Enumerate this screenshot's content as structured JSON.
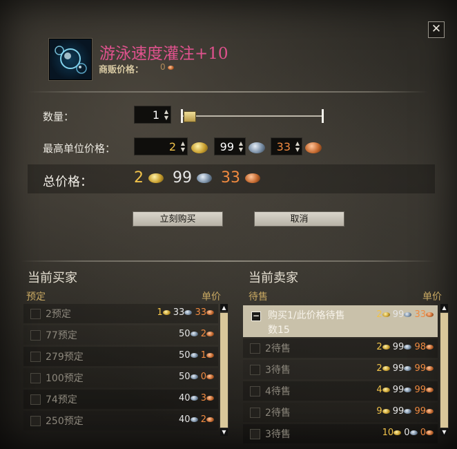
{
  "close_label": "✕",
  "item": {
    "title": "游泳速度灌注+10",
    "icon": "water-bubbles-icon",
    "vendor_label": "商贩价格：",
    "vendor_value": "0"
  },
  "quantity": {
    "label": "数量：",
    "value": "1",
    "slider_fraction": 0.05
  },
  "max_unit_price": {
    "label": "最高单位价格：",
    "gold": "2",
    "silver": "99",
    "copper": "33"
  },
  "total": {
    "label": "总价格：",
    "gold": "2",
    "silver": "99",
    "copper": "33"
  },
  "buttons": {
    "buy_now": "立刻购买",
    "cancel": "取消"
  },
  "buyers": {
    "title": "当前买家",
    "col_left": "预定",
    "col_right": "单价",
    "rows": [
      {
        "label": "2预定",
        "gold": "1",
        "silver": "33",
        "copper": "33"
      },
      {
        "label": "77预定",
        "gold": "",
        "silver": "50",
        "copper": "2"
      },
      {
        "label": "279预定",
        "gold": "",
        "silver": "50",
        "copper": "1"
      },
      {
        "label": "100预定",
        "gold": "",
        "silver": "50",
        "copper": "0"
      },
      {
        "label": "74预定",
        "gold": "",
        "silver": "40",
        "copper": "3"
      },
      {
        "label": "250预定",
        "gold": "",
        "silver": "40",
        "copper": "2"
      }
    ]
  },
  "sellers": {
    "title": "当前卖家",
    "col_left": "待售",
    "col_right": "单价",
    "selected_line1": "购买1/此价格待售",
    "selected_line2": "数15",
    "selected_price": {
      "gold": "2",
      "silver": "99",
      "copper": "33"
    },
    "rows": [
      {
        "label": "2待售",
        "gold": "2",
        "silver": "99",
        "copper": "98"
      },
      {
        "label": "3待售",
        "gold": "2",
        "silver": "99",
        "copper": "99"
      },
      {
        "label": "4待售",
        "gold": "4",
        "silver": "99",
        "copper": "99"
      },
      {
        "label": "2待售",
        "gold": "9",
        "silver": "99",
        "copper": "99"
      },
      {
        "label": "3待售",
        "gold": "10",
        "silver": "0",
        "copper": "0"
      }
    ]
  },
  "colors": {
    "title_pink": "#e0528e",
    "gold": "#f0c24a",
    "copper": "#f08a40",
    "selected_row": "#c9c1aa"
  }
}
